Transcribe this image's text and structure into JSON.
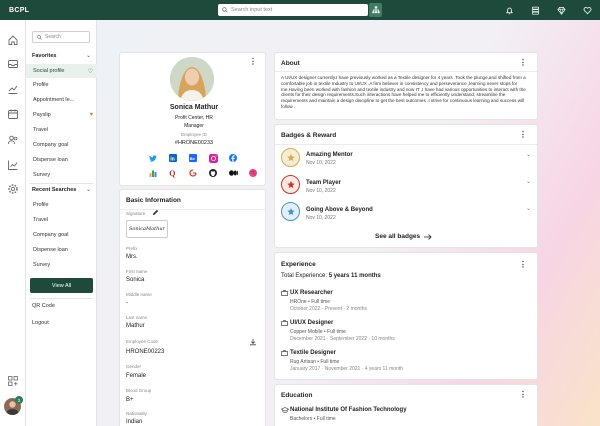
{
  "topbar": {
    "brand": "BCPL",
    "search_placeholder": "Search input text"
  },
  "sidebar": {
    "search_placeholder": "Search",
    "favorites_label": "Favorites",
    "favorites": [
      {
        "label": "Social profile",
        "icon": "heart-outline-icon"
      },
      {
        "label": "Profile"
      },
      {
        "label": "Appointment le..."
      },
      {
        "label": "Payslip",
        "icon": "heart-filled-icon"
      },
      {
        "label": "Travel"
      },
      {
        "label": "Company goal"
      },
      {
        "label": "Dispense loan"
      },
      {
        "label": "Survey"
      }
    ],
    "recent_label": "Recent Searches",
    "recent": [
      {
        "label": "Profile"
      },
      {
        "label": "Travel"
      },
      {
        "label": "Company goal"
      },
      {
        "label": "Dispense loan"
      },
      {
        "label": "Survey"
      }
    ],
    "view_all": "View All",
    "links": [
      "QR Code",
      "Logout"
    ],
    "avatar_badge": "3"
  },
  "profile": {
    "name": "Sonica Mathur",
    "unit": "Profit Center, HR",
    "designation": "Manager",
    "employee_id_label": "Employee ID",
    "employee_id": "#HRONE00233",
    "social_icons_row1": [
      "twitter-icon",
      "linkedin-icon",
      "behance-icon",
      "instagram-icon",
      "facebook-icon"
    ],
    "social_icons_row2": [
      "bar-chart-icon",
      "quora-icon",
      "github-icon",
      "medium-icon",
      "dribbble-icon"
    ]
  },
  "basic_info": {
    "title": "Basic Information",
    "signature_label": "Signature",
    "signature_text": "SonicaMathur",
    "fields": [
      {
        "label": "Prefix",
        "value": "Mrs."
      },
      {
        "label": "First name",
        "value": "Sonica"
      },
      {
        "label": "Middle name",
        "value": "-"
      },
      {
        "label": "Last name",
        "value": "Mathur"
      },
      {
        "label": "Employee Code",
        "value": "HRONE00223"
      },
      {
        "label": "Gender",
        "value": "Female"
      },
      {
        "label": "Blood Group",
        "value": "B+"
      },
      {
        "label": "Nationality",
        "value": "Indian"
      }
    ]
  },
  "about": {
    "title": "About",
    "text": "A UI/UX designer currently.I have previously worked as a Textile designer for 4 years .Took the plunge,and shifted from a comfortable job in textile Industry to UI/UX .A firm believer in consistency and perseverance ,learning never stops for me.Having been worked with fashion and textile industry and now IT ,I have had various opportunities to interact with the clients for their design requirements.Such interactions have helped me to efficiently understand, streamline the requirements and maintain a design discipline to get the best outcomes .I strive for continuous learning and success will follow ."
  },
  "badges": {
    "title": "Badges & Reward",
    "items": [
      {
        "name": "Amazing Mentor",
        "date": "Nov 10, 2022",
        "color": "#d8a94a"
      },
      {
        "name": "Team Player",
        "date": "Nov 10, 2022",
        "color": "#c0392b"
      },
      {
        "name": "Going Above & Beyond",
        "date": "Nov 10, 2022",
        "color": "#4a90c8"
      }
    ],
    "see_all": "See all badges"
  },
  "experience": {
    "title": "Experience",
    "total_label": "Total Experience:",
    "total_value": "5 years 11 months",
    "items": [
      {
        "title": "UX Researcher",
        "sub": "HROne • Full time",
        "dates": "October 2022 · Present · 2 months"
      },
      {
        "title": "UI/UX Designer",
        "sub": "Copper Mobile • Full time",
        "dates": "December 2021 · September 2022 · 10 months"
      },
      {
        "title": "Textile Designer",
        "sub": "Rug Artisan • Full time",
        "dates": "January 2017 · November 2021 · 4 years 11 month"
      }
    ]
  },
  "education": {
    "title": "Education",
    "items": [
      {
        "school": "National Institute Of Fashion Technology",
        "sub": "Bachelors • Full time"
      }
    ]
  },
  "colors": {
    "brand": "#1d4a3a",
    "accent": "#3f7d63",
    "active_bg": "#e8f1ec"
  }
}
